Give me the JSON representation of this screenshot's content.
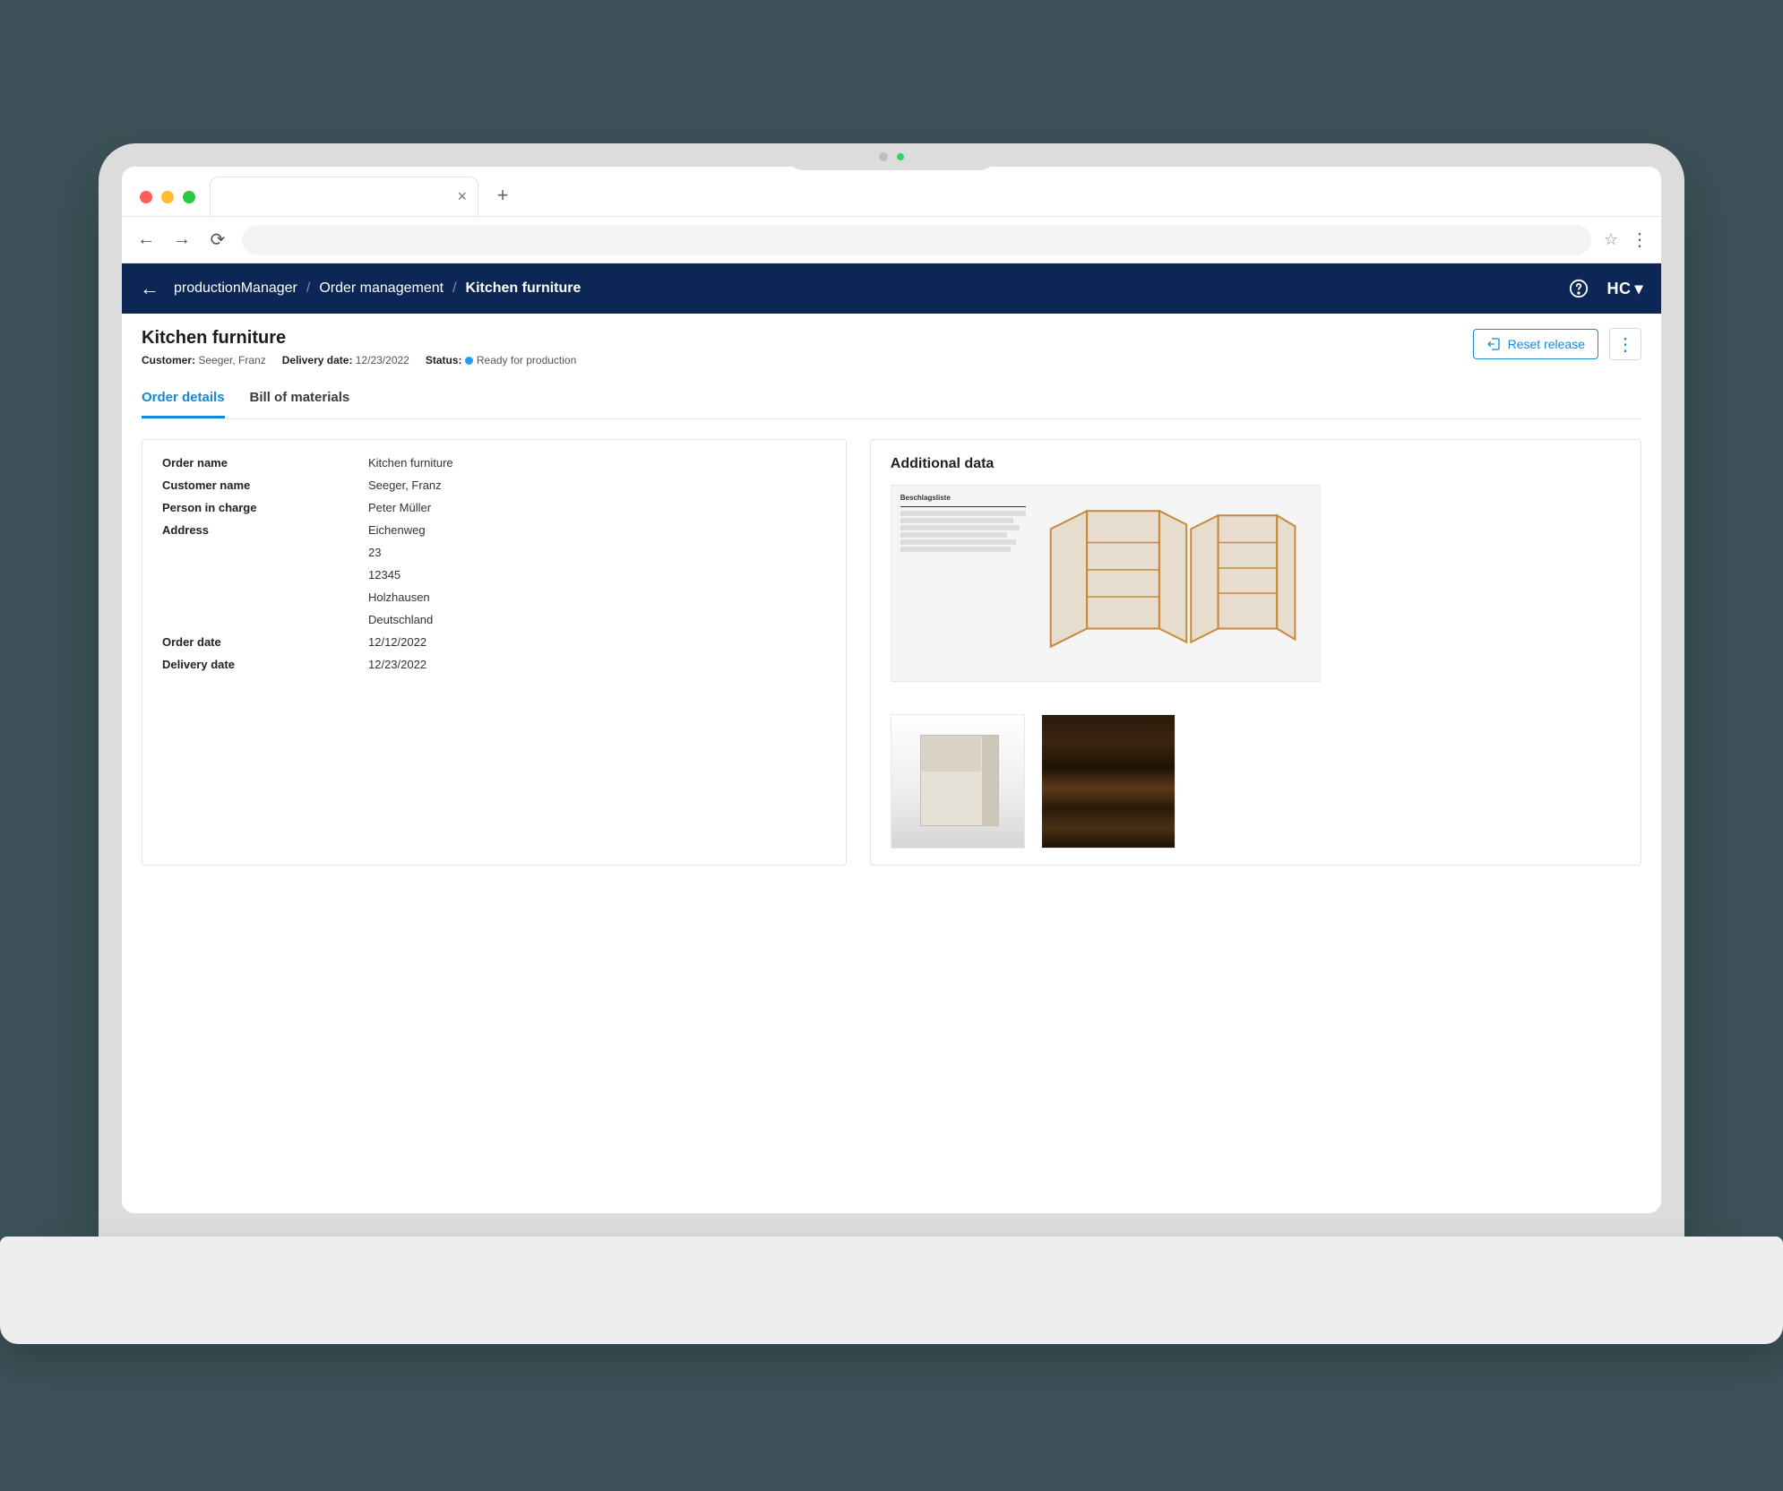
{
  "breadcrumb": {
    "app": "productionManager",
    "section": "Order management",
    "current": "Kitchen furniture"
  },
  "header": {
    "brand": "HC"
  },
  "page": {
    "title": "Kitchen furniture",
    "customer_label": "Customer:",
    "customer_value": "Seeger, Franz",
    "delivery_label": "Delivery date:",
    "delivery_value": "12/23/2022",
    "status_label": "Status:",
    "status_value": "Ready for production",
    "reset_label": "Reset release"
  },
  "tabs": {
    "order_details": "Order details",
    "bom": "Bill of materials"
  },
  "details": {
    "order_name_label": "Order name",
    "order_name_value": "Kitchen furniture",
    "customer_name_label": "Customer name",
    "customer_name_value": "Seeger, Franz",
    "person_label": "Person in charge",
    "person_value": "Peter Müller",
    "address_label": "Address",
    "address_street": "Eichenweg",
    "address_number": "23",
    "address_zip": "12345",
    "address_city": "Holzhausen",
    "address_country": "Deutschland",
    "order_date_label": "Order date",
    "order_date_value": "12/12/2022",
    "delivery_date_label": "Delivery date",
    "delivery_date_value": "12/23/2022"
  },
  "additional": {
    "title": "Additional data",
    "doc_label": "Beschlagsliste"
  }
}
